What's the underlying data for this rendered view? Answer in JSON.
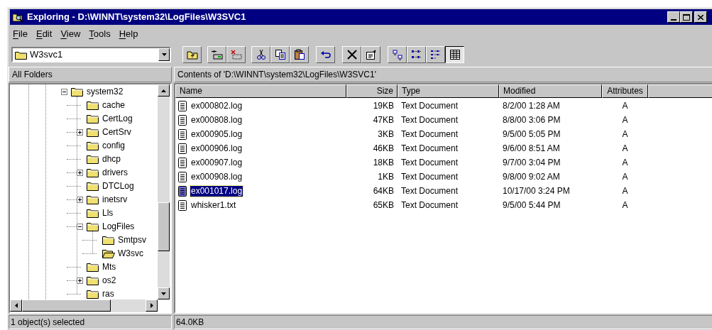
{
  "window": {
    "title": "Exploring - D:\\WINNT\\system32\\LogFiles\\W3SVC1"
  },
  "menu": [
    "File",
    "Edit",
    "View",
    "Tools",
    "Help"
  ],
  "address": {
    "value": "W3svc1"
  },
  "toolbar": [
    {
      "kind": "up-folder",
      "pressed": false
    },
    {
      "kind": "map-drive",
      "pressed": false
    },
    {
      "kind": "disconnect",
      "pressed": false
    },
    {
      "kind": "cut",
      "pressed": false
    },
    {
      "kind": "copy",
      "pressed": false
    },
    {
      "kind": "paste",
      "pressed": false
    },
    {
      "kind": "undo",
      "pressed": false
    },
    {
      "kind": "delete",
      "pressed": false
    },
    {
      "kind": "properties",
      "pressed": false
    },
    {
      "kind": "large-icons",
      "pressed": false
    },
    {
      "kind": "small-icons",
      "pressed": false
    },
    {
      "kind": "list",
      "pressed": false
    },
    {
      "kind": "details",
      "pressed": true
    }
  ],
  "folders_header": "All Folders",
  "contents_header": "Contents of 'D:\\WINNT\\system32\\LogFiles\\W3SVC1'",
  "tree": [
    {
      "name": "system32",
      "expanded": true,
      "selected": false,
      "children": [
        {
          "name": "cache",
          "selected": false
        },
        {
          "name": "CertLog",
          "selected": false
        },
        {
          "name": "CertSrv",
          "expanded": false,
          "selected": false
        },
        {
          "name": "config",
          "selected": false
        },
        {
          "name": "dhcp",
          "selected": false
        },
        {
          "name": "drivers",
          "expanded": false,
          "selected": false
        },
        {
          "name": "DTCLog",
          "selected": false
        },
        {
          "name": "inetsrv",
          "expanded": false,
          "selected": false
        },
        {
          "name": "Lls",
          "selected": false
        },
        {
          "name": "LogFiles",
          "expanded": true,
          "selected": false,
          "children": [
            {
              "name": "Smtpsv",
              "selected": false
            },
            {
              "name": "W3svc",
              "selected": true
            }
          ]
        },
        {
          "name": "Mts",
          "selected": false
        },
        {
          "name": "os2",
          "expanded": false,
          "selected": false
        },
        {
          "name": "ras",
          "selected": false
        }
      ]
    }
  ],
  "table": {
    "columns": [
      "Name",
      "Size",
      "Type",
      "Modified",
      "Attributes"
    ],
    "rows": [
      {
        "name": "ex000802.log",
        "size": "19KB",
        "type": "Text Document",
        "modified": "8/2/00 1:28 AM",
        "attributes": "A",
        "selected": false
      },
      {
        "name": "ex000808.log",
        "size": "47KB",
        "type": "Text Document",
        "modified": "8/8/00 3:06 PM",
        "attributes": "A",
        "selected": false
      },
      {
        "name": "ex000905.log",
        "size": "3KB",
        "type": "Text Document",
        "modified": "9/5/00 5:05 PM",
        "attributes": "A",
        "selected": false
      },
      {
        "name": "ex000906.log",
        "size": "46KB",
        "type": "Text Document",
        "modified": "9/6/00 8:51 AM",
        "attributes": "A",
        "selected": false
      },
      {
        "name": "ex000907.log",
        "size": "18KB",
        "type": "Text Document",
        "modified": "9/7/00 3:04 PM",
        "attributes": "A",
        "selected": false
      },
      {
        "name": "ex000908.log",
        "size": "1KB",
        "type": "Text Document",
        "modified": "9/8/00 9:02 AM",
        "attributes": "A",
        "selected": false
      },
      {
        "name": "ex001017.log",
        "size": "64KB",
        "type": "Text Document",
        "modified": "10/17/00 3:24 PM",
        "attributes": "A",
        "selected": true
      },
      {
        "name": "whisker1.txt",
        "size": "65KB",
        "type": "Text Document",
        "modified": "9/5/00 5:44 PM",
        "attributes": "A",
        "selected": false
      }
    ]
  },
  "status_bar": [
    "1 object(s) selected",
    "64.0KB"
  ]
}
